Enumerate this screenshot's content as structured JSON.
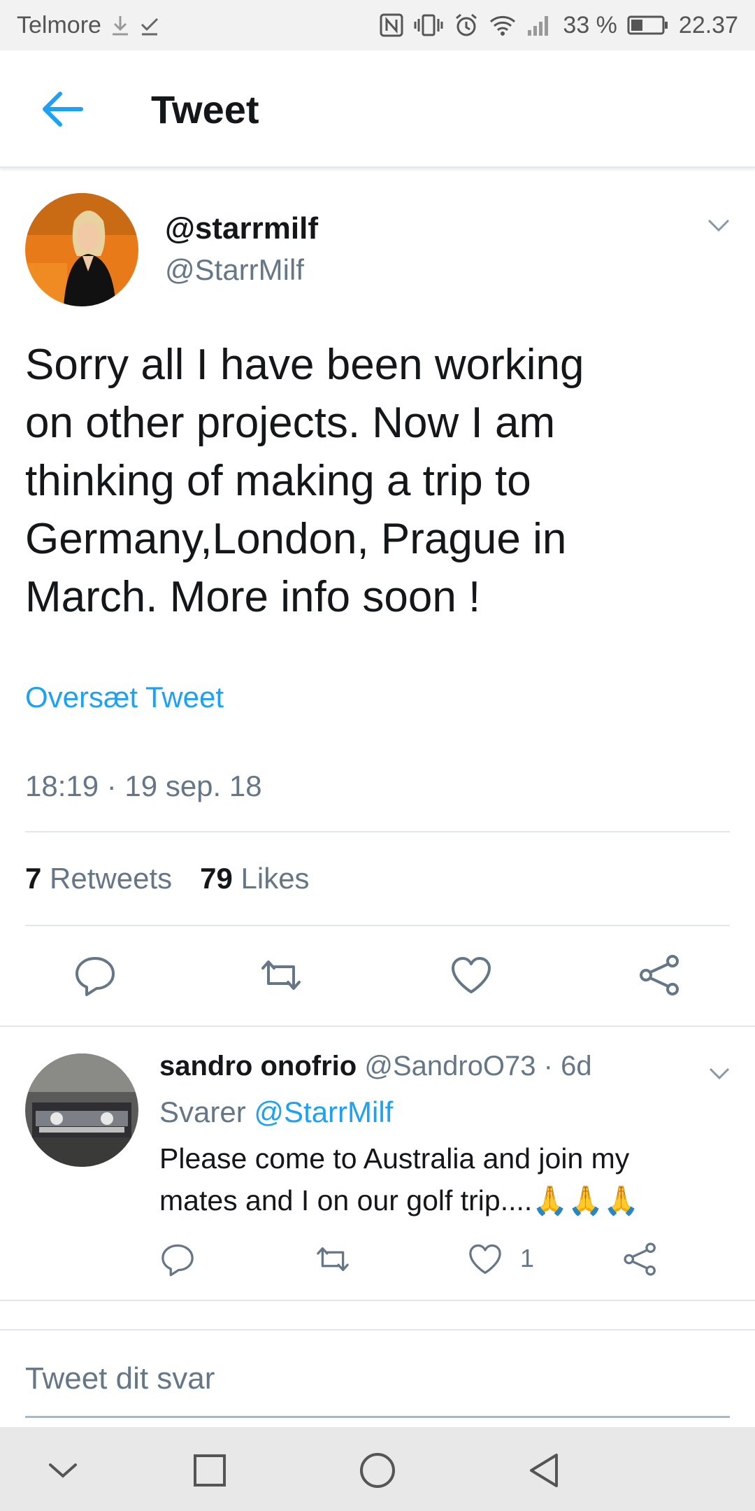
{
  "status_bar": {
    "carrier": "Telmore",
    "battery_percent": "33 %",
    "time": "22.37"
  },
  "app_bar": {
    "title": "Tweet"
  },
  "tweet": {
    "display_name": "@starrmilf",
    "handle": "@StarrMilf",
    "text_lines": [
      "Sorry all I have been working",
      "on other projects. Now I am",
      "thinking of making a trip to",
      "Germany,London, Prague in",
      "March. More info soon !"
    ],
    "translate_label": "Oversæt Tweet",
    "timestamp": "18:19 · 19 sep. 18",
    "retweets_count": "7",
    "retweets_label": "Retweets",
    "likes_count": "79",
    "likes_label": "Likes"
  },
  "reply": {
    "name": "sandro onofrio",
    "handle": "@SandroO73",
    "age": "· 6d",
    "replying_prefix": "Svarer",
    "replying_to": "@StarrMilf",
    "text_line1": "Please come to Australia and join my",
    "text_line2": "mates and I on our golf trip....🙏🙏🙏",
    "like_count": "1"
  },
  "compose": {
    "placeholder": "Tweet dit svar"
  },
  "colors": {
    "accent": "#1da1f2",
    "secondary_text": "#657786",
    "divider": "#e1e8ed"
  }
}
